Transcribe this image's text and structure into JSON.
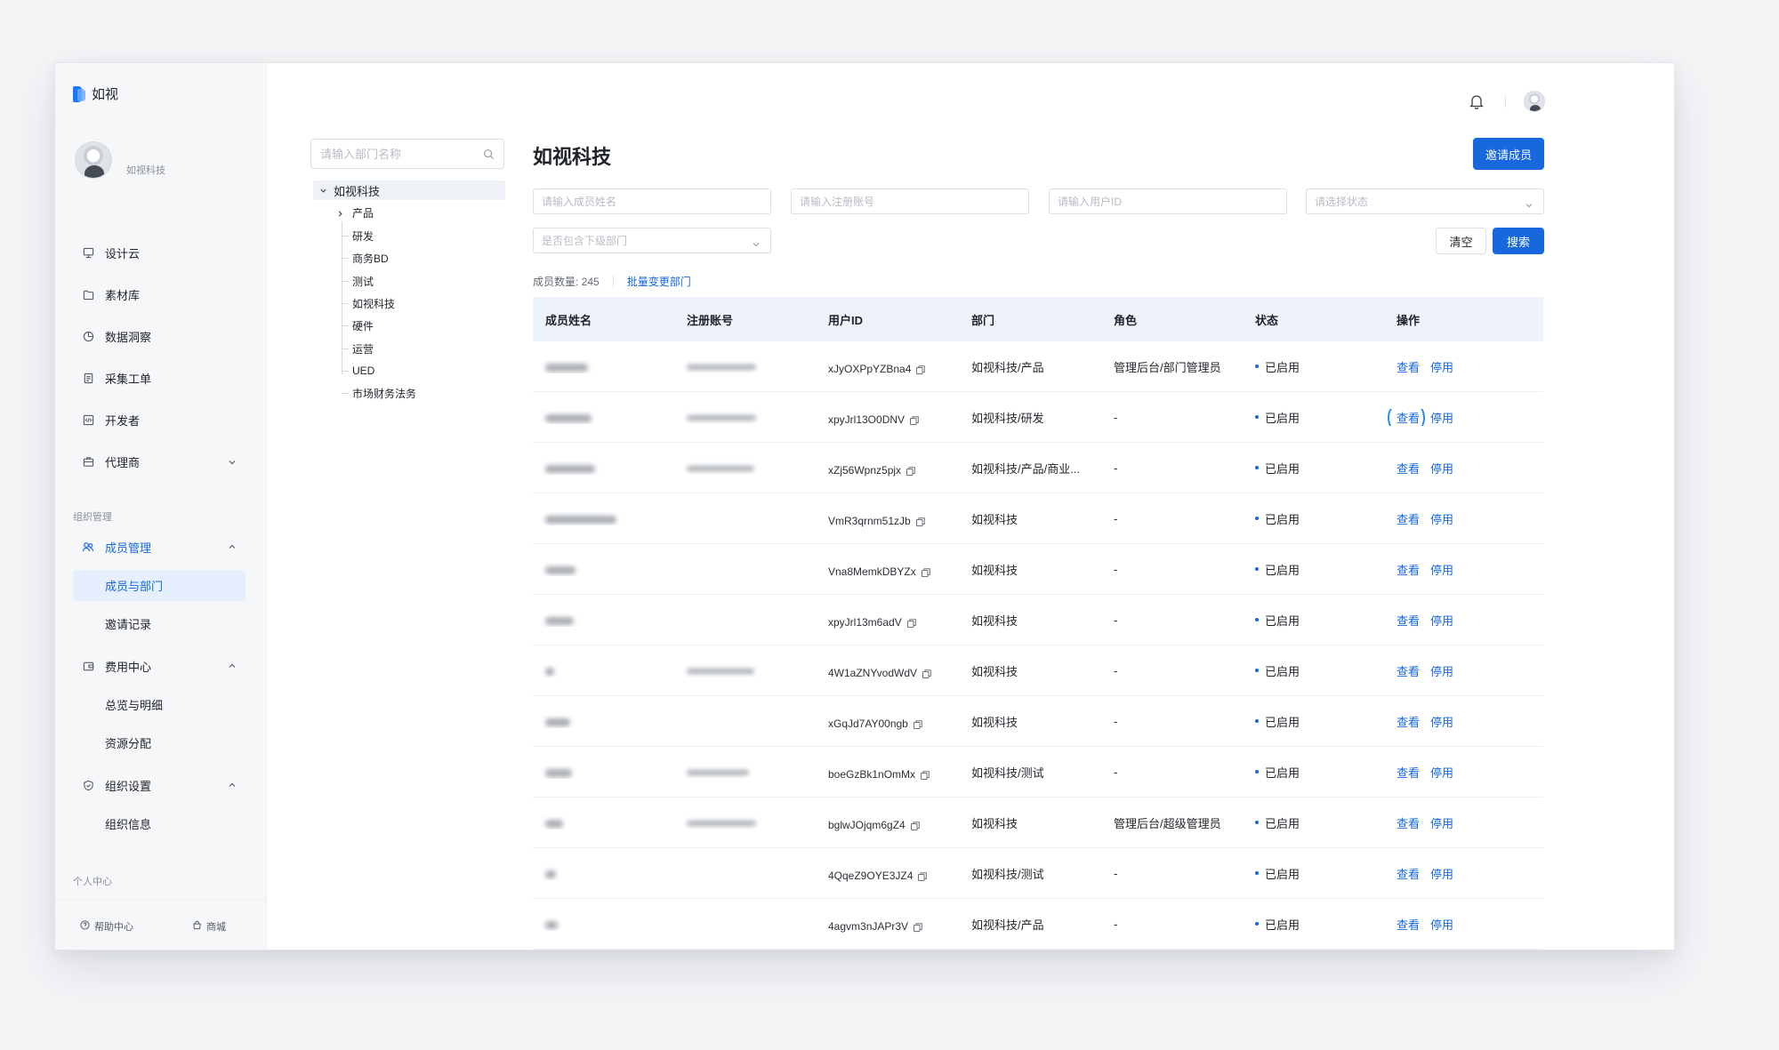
{
  "app": {
    "logo_text": "如视"
  },
  "profile": {
    "org_name": "如视科技"
  },
  "nav": {
    "items": [
      {
        "label": "设计云",
        "icon": "monitor-icon"
      },
      {
        "label": "素材库",
        "icon": "folder-icon"
      },
      {
        "label": "数据洞察",
        "icon": "pie-chart-icon"
      },
      {
        "label": "采集工单",
        "icon": "document-icon"
      },
      {
        "label": "开发者",
        "icon": "code-icon"
      },
      {
        "label": "代理商",
        "icon": "briefcase-icon"
      }
    ],
    "org_section_title": "组织管理",
    "member_mgmt": "成员管理",
    "member_dept": "成员与部门",
    "invite_records": "邀请记录",
    "billing": "费用中心",
    "overview": "总览与明细",
    "resource": "资源分配",
    "org_settings": "组织设置",
    "org_info": "组织信息",
    "personal_section_title": "个人中心"
  },
  "footer": {
    "help": "帮助中心",
    "store": "商城"
  },
  "dept": {
    "search_placeholder": "请输入部门名称",
    "root": "如视科技",
    "children": [
      "产品",
      "研发",
      "商务BD",
      "测试",
      "如视科技",
      "硬件",
      "运营",
      "UED",
      "市场财务法务"
    ]
  },
  "main": {
    "title": "如视科技",
    "invite_button": "邀请成员",
    "filters": {
      "name_placeholder": "请输入成员姓名",
      "account_placeholder": "请输入注册账号",
      "uid_placeholder": "请输入用户ID",
      "status_placeholder": "请选择状态",
      "subdept_placeholder": "是否包含下级部门"
    },
    "clear_button": "清空",
    "search_button": "搜索",
    "count_text": "成员数量: 245",
    "batch_link": "批量变更部门"
  },
  "table": {
    "headers": [
      "成员姓名",
      "注册账号",
      "用户ID",
      "部门",
      "角色",
      "状态",
      "操作"
    ],
    "view_label": "查看",
    "disable_label": "停用",
    "rows": [
      {
        "uid": "xJyOXPpYZBna4",
        "dept": "如视科技/产品",
        "role": "管理后台/部门管理员",
        "status": "已启用"
      },
      {
        "uid": "xpyJrl13O0DNV",
        "dept": "如视科技/研发",
        "role": "-",
        "status": "已启用"
      },
      {
        "uid": "xZj56Wpnz5pjx",
        "dept": "如视科技/产品/商业...",
        "role": "-",
        "status": "已启用"
      },
      {
        "uid": "VmR3qrnm51zJb",
        "dept": "如视科技",
        "role": "-",
        "status": "已启用"
      },
      {
        "uid": "Vna8MemkDBYZx",
        "dept": "如视科技",
        "role": "-",
        "status": "已启用"
      },
      {
        "uid": "xpyJrl13m6adV",
        "dept": "如视科技",
        "role": "-",
        "status": "已启用"
      },
      {
        "uid": "4W1aZNYvodWdV",
        "dept": "如视科技",
        "role": "-",
        "status": "已启用"
      },
      {
        "uid": "xGqJd7AY00ngb",
        "dept": "如视科技",
        "role": "-",
        "status": "已启用"
      },
      {
        "uid": "boeGzBk1nOmMx",
        "dept": "如视科技/测试",
        "role": "-",
        "status": "已启用"
      },
      {
        "uid": "bglwJOjqm6gZ4",
        "dept": "如视科技",
        "role": "管理后台/超级管理员",
        "status": "已启用"
      },
      {
        "uid": "4QqeZ9OYE3JZ4",
        "dept": "如视科技/测试",
        "role": "-",
        "status": "已启用"
      },
      {
        "uid": "4agvm3nJAPr3V",
        "dept": "如视科技/产品",
        "role": "-",
        "status": "已启用"
      }
    ]
  },
  "colors": {
    "accent": "#1668dc",
    "header_bg": "#edf2fb",
    "active_bg": "#e6effd"
  }
}
